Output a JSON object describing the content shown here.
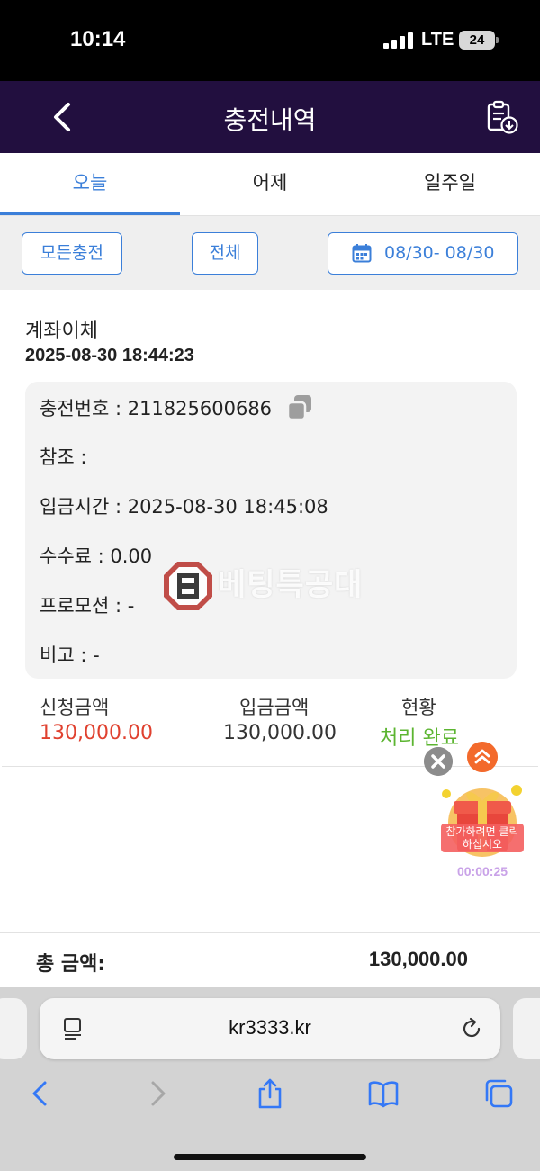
{
  "status_bar": {
    "time": "10:14",
    "network": "LTE",
    "battery": "24"
  },
  "header": {
    "title": "충전내역"
  },
  "tabs": [
    {
      "label": "오늘",
      "active": true
    },
    {
      "label": "어제",
      "active": false
    },
    {
      "label": "일주일",
      "active": false
    }
  ],
  "filters": {
    "type": "모든충전",
    "status": "전체",
    "date_range": "08/30- 08/30"
  },
  "record": {
    "method": "계좌이체",
    "datetime": "2025-08-30 18:44:23",
    "details": {
      "charge_no": "충전번호 : 211825600686",
      "reference": "참조 :",
      "deposit_time": "입금시간 : 2025-08-30 18:45:08",
      "fee": "수수료 : 0.00",
      "promotion": "프로모션 : -",
      "note": "비고 : -"
    },
    "columns": {
      "requested_label": "신청금액",
      "requested_value": "130,000.00",
      "deposited_label": "입금금액",
      "deposited_value": "130,000.00",
      "status_label": "현황",
      "status_value": "처리 완료"
    }
  },
  "watermark": {
    "text": "베팅특공대"
  },
  "gift": {
    "label": "참가하려면 클릭하십시오",
    "timer": "00:00:25"
  },
  "total": {
    "label": "총 금액:",
    "value": "130,000.00"
  },
  "browser": {
    "url": "kr3333.kr"
  },
  "colors": {
    "header_bg": "#220f3f",
    "accent": "#3b7fd9",
    "requested": "#e0412f",
    "status_done": "#5cb531"
  },
  "icons": [
    "back-icon",
    "download-list-icon",
    "calendar-icon",
    "copy-icon",
    "close-icon",
    "scroll-top-icon",
    "gift-icon",
    "reader-icon",
    "reload-icon",
    "browser-back-icon",
    "browser-forward-icon",
    "share-icon",
    "bookmarks-icon",
    "tabs-icon"
  ]
}
